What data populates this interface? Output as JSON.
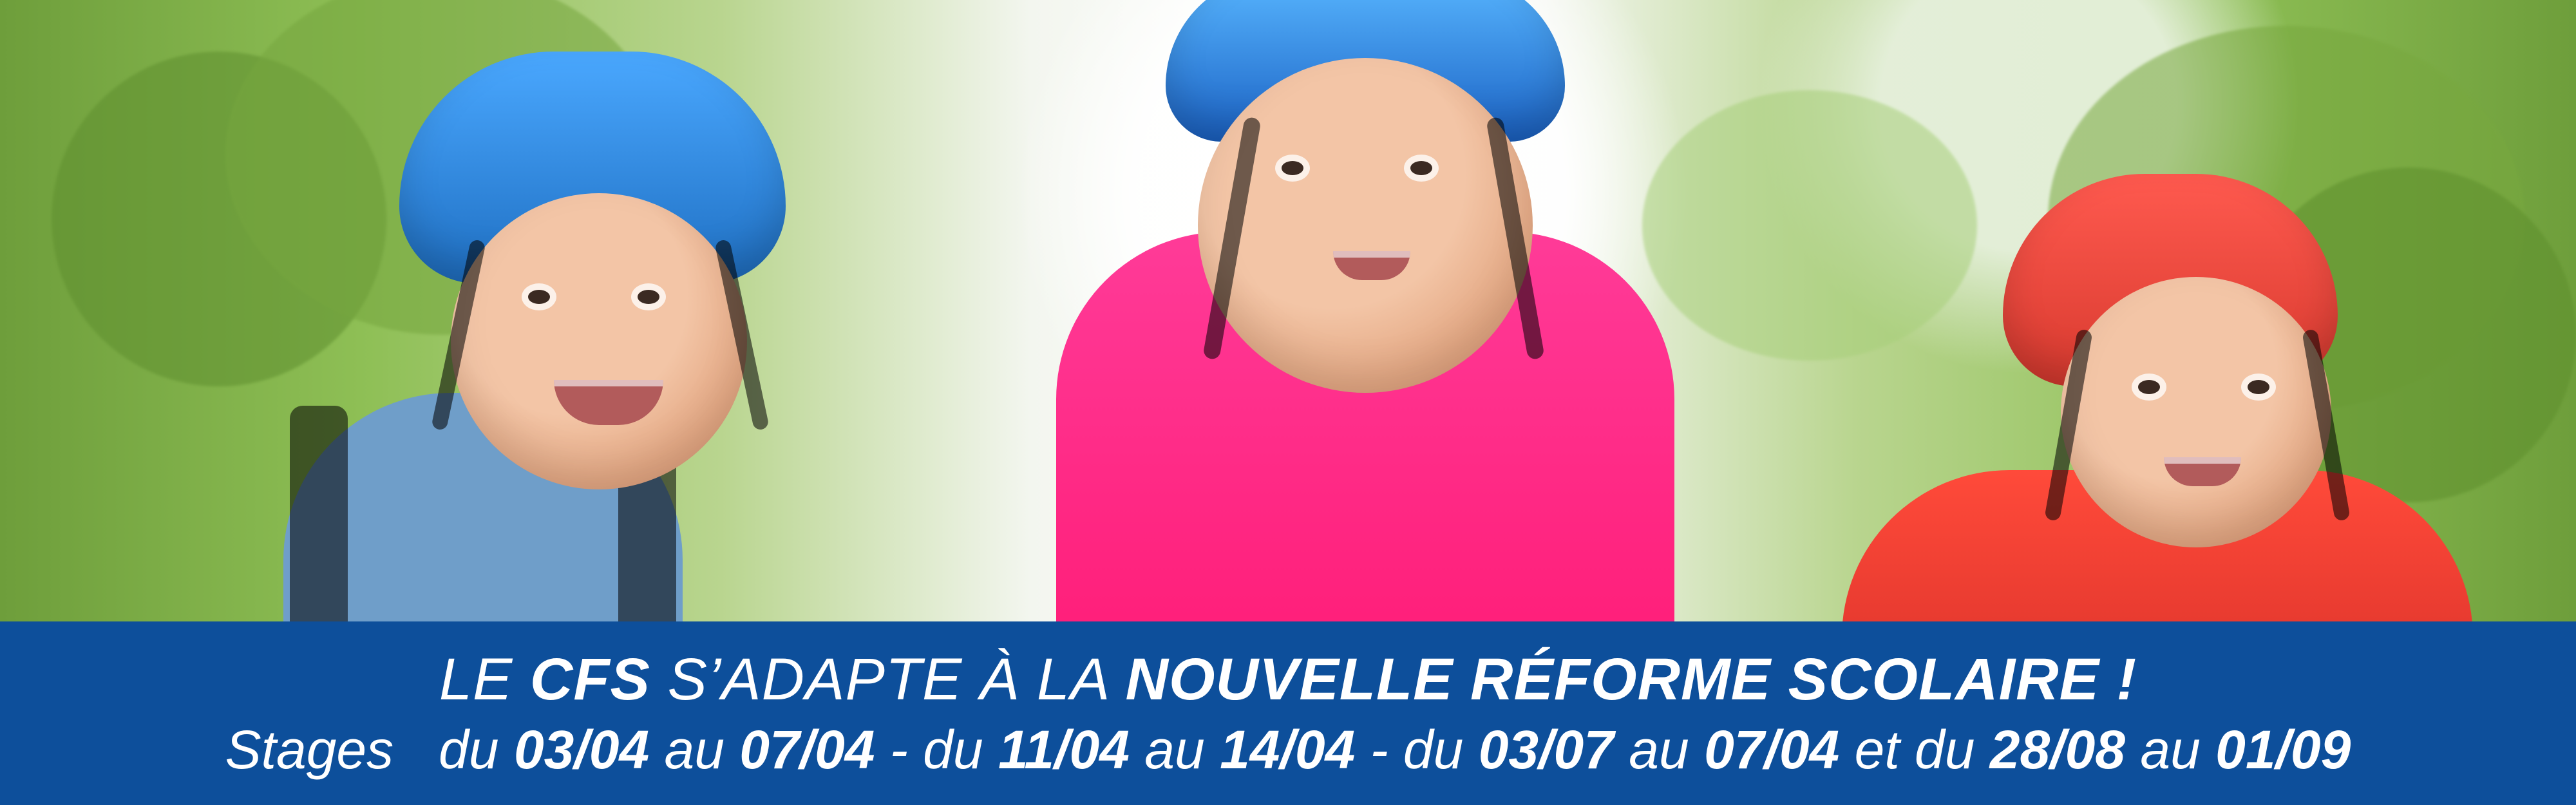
{
  "banner": {
    "headline": {
      "prefix": "LE ",
      "brand": "CFS",
      "mid": " S’ADAPTE À LA ",
      "emphasis": "NOUVELLE RÉFORME SCOLAIRE !"
    },
    "dates_line": {
      "label": "Stages",
      "parts": [
        {
          "t": "du ",
          "b": false
        },
        {
          "t": "03/04",
          "b": true
        },
        {
          "t": " au ",
          "b": false
        },
        {
          "t": "07/04",
          "b": true
        },
        {
          "t": " - du ",
          "b": false
        },
        {
          "t": "11/04",
          "b": true
        },
        {
          "t": " au ",
          "b": false
        },
        {
          "t": "14/04",
          "b": true
        },
        {
          "t": " - du ",
          "b": false
        },
        {
          "t": "03/07",
          "b": true
        },
        {
          "t": " au ",
          "b": false
        },
        {
          "t": "07/04",
          "b": true
        },
        {
          "t": " et du ",
          "b": false
        },
        {
          "t": "28/08",
          "b": true
        },
        {
          "t": " au ",
          "b": false
        },
        {
          "t": "01/09",
          "b": true
        }
      ]
    },
    "colors": {
      "footer_bg": "#0d4f9b",
      "text": "#ffffff",
      "helmet_blue": "#1f6fc2",
      "helmet_red": "#d83a2f",
      "shirt_pink": "#ff2d8a",
      "shirt_red": "#e5332f",
      "tank_blue": "#6f9ec9"
    }
  }
}
